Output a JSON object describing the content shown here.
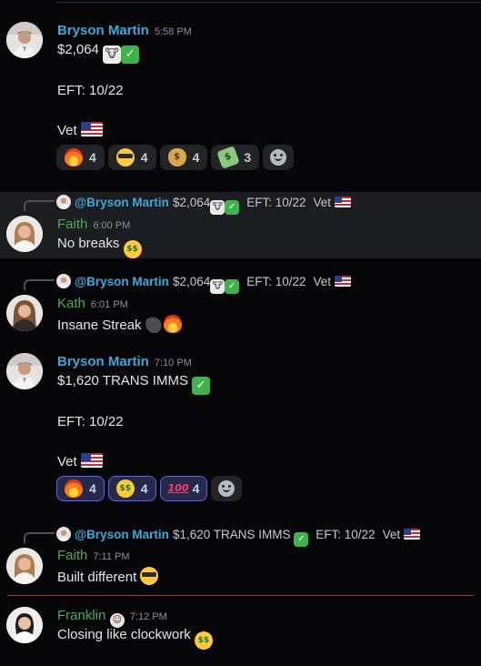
{
  "messages": [
    {
      "author": "Bryson Martin",
      "time": "5:58 PM",
      "line1": "$2,064",
      "line2": "EFT: 10/22",
      "line3": "Vet",
      "reactions": [
        {
          "emoji": "fire",
          "count": "4"
        },
        {
          "emoji": "smiling-face-with-sunglasses",
          "count": "4"
        },
        {
          "emoji": "money-bag",
          "count": "4"
        },
        {
          "emoji": "money-with-wings",
          "count": "3"
        }
      ]
    },
    {
      "reply": {
        "author": "@Bryson Martin",
        "text1": "$2,064",
        "text2": "EFT: 10/22",
        "text3": "Vet"
      },
      "author": "Faith",
      "time": "6:00 PM",
      "text": "No breaks"
    },
    {
      "reply": {
        "author": "@Bryson Martin",
        "text1": "$2,064",
        "text2": "EFT: 10/22",
        "text3": "Vet"
      },
      "author": "Kath",
      "time": "6:01 PM",
      "text": "Insane Streak"
    },
    {
      "author": "Bryson Martin",
      "time": "7:10 PM",
      "line1": "$1,620 TRANS IMMS",
      "line2": "EFT: 10/22",
      "line3": "Vet",
      "reactions": [
        {
          "emoji": "fire",
          "count": "4"
        },
        {
          "emoji": "money-mouth-face",
          "count": "4"
        },
        {
          "emoji": "hundred-points",
          "count": "4"
        }
      ]
    },
    {
      "reply": {
        "author": "@Bryson Martin",
        "text1": "$1,620 TRANS IMMS",
        "text2": "EFT: 10/22",
        "text3": "Vet"
      },
      "author": "Faith",
      "time": "7:11 PM",
      "text": "Built different"
    },
    {
      "author": "Franklin",
      "time": "7:12 PM",
      "text": "Closing like clockwork"
    }
  ],
  "colors": {
    "background": "#070709",
    "username_blue": "#3fa7da",
    "username_green": "#4dab55",
    "reaction_active_border": "#5865f2",
    "new_messages_divider": "#a33535"
  },
  "icons": [
    "add-reaction-icon",
    "cow-face-emoji",
    "check-mark-emoji",
    "us-flag-emoji"
  ]
}
